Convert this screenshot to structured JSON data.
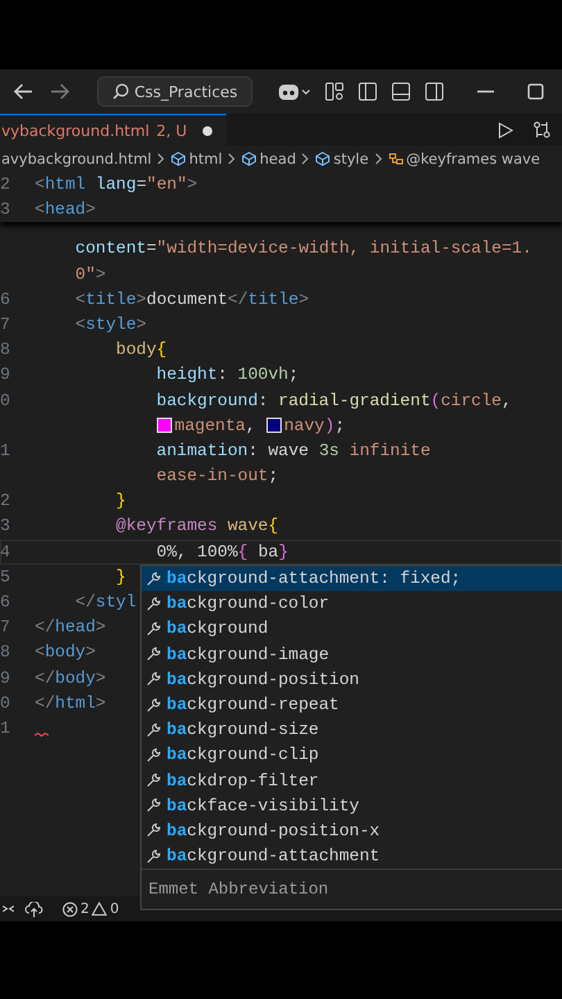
{
  "title_bar": {
    "search": "Css_Practices"
  },
  "tab": {
    "label": "vybackground.html",
    "badge": "2, U",
    "modified": true
  },
  "breadcrumb": [
    {
      "label": "avybackground.html",
      "kind": "file"
    },
    {
      "label": "html",
      "kind": "element"
    },
    {
      "label": "head",
      "kind": "element"
    },
    {
      "label": "style",
      "kind": "element"
    },
    {
      "label": "@keyframes wave",
      "kind": "keyframes"
    }
  ],
  "sticky_lines": [
    {
      "number": "2",
      "tokens": [
        {
          "text": "<",
          "kind": "punct"
        },
        {
          "text": "html",
          "kind": "tag"
        },
        {
          "text": " lang",
          "kind": "attr"
        },
        {
          "text": "=",
          "kind": "text"
        },
        {
          "text": "\"en\"",
          "kind": "string"
        },
        {
          "text": ">",
          "kind": "punct"
        }
      ]
    },
    {
      "number": "3",
      "tokens": [
        {
          "text": "<",
          "kind": "punct"
        },
        {
          "text": "head",
          "kind": "tag"
        },
        {
          "text": ">",
          "kind": "punct"
        }
      ]
    }
  ],
  "lines": [
    {
      "current": false,
      "tokens": [
        {
          "text": "    content",
          "kind": "attr"
        },
        {
          "text": "=",
          "kind": "text"
        },
        {
          "text": "\"width=device-width, initial-scale=1.",
          "kind": "string"
        }
      ]
    },
    {
      "current": false,
      "tokens": [
        {
          "text": "    0\"",
          "kind": "string"
        },
        {
          "text": ">",
          "kind": "punct"
        }
      ]
    },
    {
      "number": "6",
      "current": false,
      "tokens": [
        {
          "text": "    <",
          "kind": "punct"
        },
        {
          "text": "title",
          "kind": "tag"
        },
        {
          "text": ">",
          "kind": "punct"
        },
        {
          "text": "document",
          "kind": "text"
        },
        {
          "text": "</",
          "kind": "punct"
        },
        {
          "text": "title",
          "kind": "tag"
        },
        {
          "text": ">",
          "kind": "punct"
        }
      ]
    },
    {
      "number": "7",
      "current": false,
      "tokens": [
        {
          "text": "    <",
          "kind": "punct"
        },
        {
          "text": "style",
          "kind": "tag"
        },
        {
          "text": ">",
          "kind": "punct"
        }
      ]
    },
    {
      "number": "8",
      "current": false,
      "tokens": [
        {
          "text": "        body",
          "kind": "selector"
        },
        {
          "text": "{",
          "kind": "brace"
        }
      ]
    },
    {
      "number": "9",
      "current": false,
      "tokens": [
        {
          "text": "            height",
          "kind": "property"
        },
        {
          "text": ": ",
          "kind": "text"
        },
        {
          "text": "100vh",
          "kind": "number"
        },
        {
          "text": ";",
          "kind": "text"
        }
      ]
    },
    {
      "number": "0",
      "current": false,
      "tokens": [
        {
          "text": "            background",
          "kind": "property"
        },
        {
          "text": ": ",
          "kind": "text"
        },
        {
          "text": "radial-gradient",
          "kind": "function"
        },
        {
          "text": "(",
          "kind": "paren"
        },
        {
          "text": "circle",
          "kind": "string"
        },
        {
          "text": ",",
          "kind": "text"
        }
      ]
    },
    {
      "current": false,
      "tokens": [
        {
          "text": "            magenta",
          "kind": "string",
          "color": "#ff00ff"
        },
        {
          "text": ", ",
          "kind": "text"
        },
        {
          "text": "navy",
          "kind": "string",
          "color": "#000080"
        },
        {
          "text": ")",
          "kind": "paren"
        },
        {
          "text": ";",
          "kind": "text"
        }
      ]
    },
    {
      "number": "1",
      "current": false,
      "tokens": [
        {
          "text": "            animation",
          "kind": "property"
        },
        {
          "text": ": ",
          "kind": "text"
        },
        {
          "text": "wave",
          "kind": "text"
        },
        {
          "text": " 3s",
          "kind": "number"
        },
        {
          "text": " infinite",
          "kind": "string"
        }
      ]
    },
    {
      "current": false,
      "tokens": [
        {
          "text": "            ease-in-out",
          "kind": "string"
        },
        {
          "text": ";",
          "kind": "text"
        }
      ]
    },
    {
      "number": "2",
      "current": false,
      "tokens": [
        {
          "text": "        }",
          "kind": "brace"
        }
      ]
    },
    {
      "number": "3",
      "current": false,
      "tokens": [
        {
          "text": "        @keyframes",
          "kind": "keyword"
        },
        {
          "text": " wave",
          "kind": "selector"
        },
        {
          "text": "{",
          "kind": "brace"
        }
      ]
    },
    {
      "number": "4",
      "current": true,
      "tokens": [
        {
          "text": "            0%, 100%",
          "kind": "text"
        },
        {
          "text": "{",
          "kind": "paren"
        },
        {
          "text": " ba",
          "kind": "text"
        },
        {
          "text": "}",
          "kind": "paren"
        }
      ]
    },
    {
      "number": "5",
      "current": false,
      "tokens": [
        {
          "text": "        }",
          "kind": "brace"
        }
      ]
    },
    {
      "number": "6",
      "current": false,
      "tokens": [
        {
          "text": "    </",
          "kind": "punct"
        },
        {
          "text": "styl",
          "kind": "tag"
        }
      ]
    },
    {
      "number": "7",
      "current": false,
      "tokens": [
        {
          "text": "</",
          "kind": "punct"
        },
        {
          "text": "head",
          "kind": "tag"
        },
        {
          "text": ">",
          "kind": "punct"
        }
      ]
    },
    {
      "number": "8",
      "current": false,
      "tokens": [
        {
          "text": "<",
          "kind": "punct"
        },
        {
          "text": "body",
          "kind": "tag"
        },
        {
          "text": ">",
          "kind": "punct"
        }
      ]
    },
    {
      "number": "9",
      "current": false,
      "tokens": [
        {
          "text": "</",
          "kind": "punct"
        },
        {
          "text": "body",
          "kind": "tag"
        },
        {
          "text": ">",
          "kind": "punct"
        }
      ]
    },
    {
      "number": "0",
      "current": false,
      "tokens": [
        {
          "text": "</",
          "kind": "punct"
        },
        {
          "text": "html",
          "kind": "tag"
        },
        {
          "text": ">",
          "kind": "punct"
        }
      ]
    },
    {
      "number": "1",
      "current": false,
      "tokens": [
        {
          "kind": "squiggle"
        }
      ]
    }
  ],
  "suggestions": [
    {
      "label": "**ba**ckground-attachment: fixed;",
      "selected": true
    },
    {
      "label": "**ba**ckground-color",
      "selected": false
    },
    {
      "label": "**ba**ckground",
      "selected": false
    },
    {
      "label": "**ba**ckground-image",
      "selected": false
    },
    {
      "label": "**ba**ckground-position",
      "selected": false
    },
    {
      "label": "**ba**ckground-repeat",
      "selected": false
    },
    {
      "label": "**ba**ckground-size",
      "selected": false
    },
    {
      "label": "**ba**ckground-clip",
      "selected": false
    },
    {
      "label": "**ba**ckdrop-filter",
      "selected": false
    },
    {
      "label": "**ba**ckface-visibility",
      "selected": false
    },
    {
      "label": "**ba**ckground-position-x",
      "selected": false
    },
    {
      "label": "**ba**ckground-attachment",
      "selected": false
    }
  ],
  "suggest_footer": "Emmet Abbreviation",
  "status_bar": {
    "errors": "2",
    "warnings": "0"
  }
}
